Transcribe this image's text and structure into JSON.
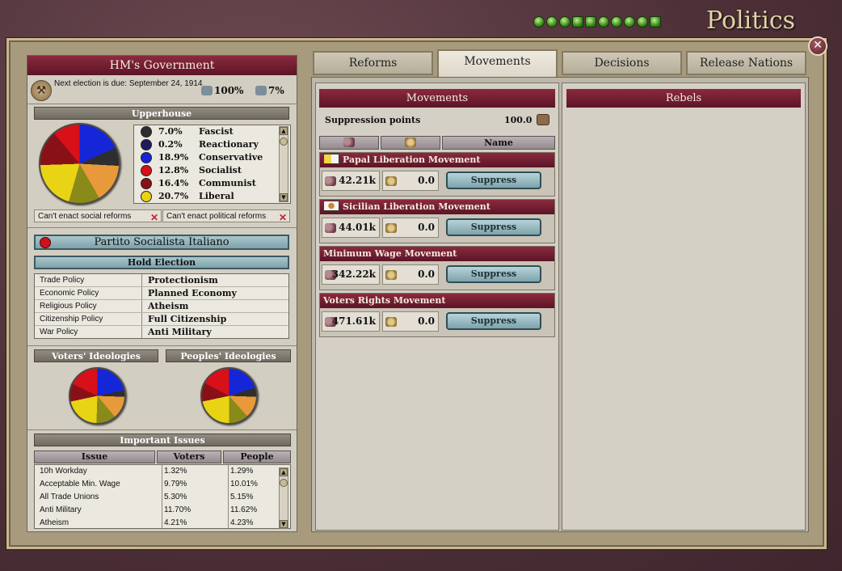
{
  "title": "Politics",
  "close_label": "✕",
  "government": {
    "name": "HM's Government",
    "next_election": "Next election is due: September 24, 1914",
    "stat1": "100%",
    "stat2": "7%"
  },
  "upperhouse": {
    "label": "Upperhouse",
    "parties": [
      {
        "pct": "7.0%",
        "name": "Fascist",
        "color": "#2e2e2e"
      },
      {
        "pct": "0.2%",
        "name": "Reactionary",
        "color": "#1c1c5e"
      },
      {
        "pct": "18.9%",
        "name": "Conservative",
        "color": "#1525d8"
      },
      {
        "pct": "12.8%",
        "name": "Socialist",
        "color": "#d81018"
      },
      {
        "pct": "16.4%",
        "name": "Communist",
        "color": "#8a1018"
      },
      {
        "pct": "20.7%",
        "name": "Liberal",
        "color": "#e8d414"
      }
    ],
    "warn_social": "Can't enact social reforms",
    "warn_political": "Can't enact political reforms"
  },
  "ruling_party": "Partito Socialista Italiano",
  "hold_election": "Hold Election",
  "policies": [
    {
      "k": "Trade Policy",
      "v": "Protectionism"
    },
    {
      "k": "Economic Policy",
      "v": "Planned Economy"
    },
    {
      "k": "Religious Policy",
      "v": "Atheism"
    },
    {
      "k": "Citizenship Policy",
      "v": "Full Citizenship"
    },
    {
      "k": "War Policy",
      "v": "Anti Military"
    }
  ],
  "ideologies": {
    "voters": "Voters' Ideologies",
    "peoples": "Peoples' Ideologies"
  },
  "issues": {
    "label": "Important Issues",
    "col_issue": "Issue",
    "col_voters": "Voters",
    "col_people": "People",
    "rows": [
      {
        "issue": "10h Workday",
        "voters": "1.32%",
        "people": "1.29%"
      },
      {
        "issue": "Acceptable Min. Wage",
        "voters": "9.79%",
        "people": "10.01%"
      },
      {
        "issue": "All Trade Unions",
        "voters": "5.30%",
        "people": "5.15%"
      },
      {
        "issue": "Anti Military",
        "voters": "11.70%",
        "people": "11.62%"
      },
      {
        "issue": "Atheism",
        "voters": "4.21%",
        "people": "4.23%"
      }
    ]
  },
  "tabs": [
    {
      "label": "Reforms"
    },
    {
      "label": "Movements"
    },
    {
      "label": "Decisions"
    },
    {
      "label": "Release Nations"
    }
  ],
  "movements": {
    "label": "Movements",
    "suppression_label": "Suppression points",
    "suppression_value": "100.0",
    "col_name": "Name",
    "suppress_label": "Suppress",
    "items": [
      {
        "name": "Papal Liberation Movement",
        "pop": "42.21k",
        "radical": "0.0"
      },
      {
        "name": "Sicilian Liberation Movement",
        "pop": "44.01k",
        "radical": "0.0"
      },
      {
        "name": "Minimum Wage Movement",
        "pop": "342.22k",
        "radical": "0.0"
      },
      {
        "name": "Voters Rights Movement",
        "pop": "471.61k",
        "radical": "0.0"
      }
    ]
  },
  "rebels": {
    "label": "Rebels"
  }
}
